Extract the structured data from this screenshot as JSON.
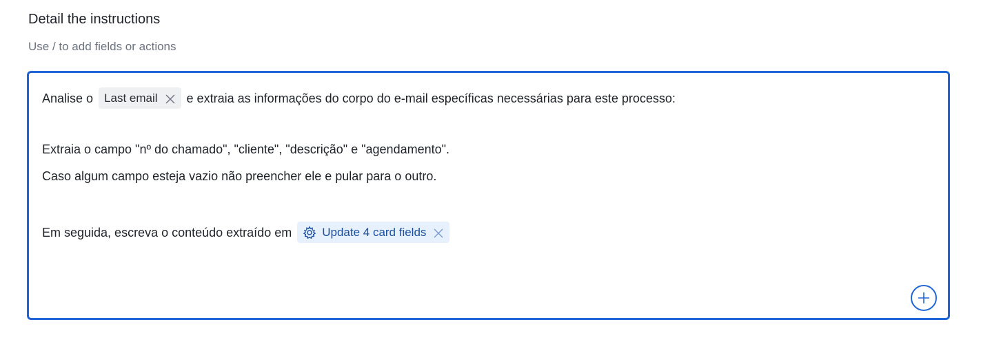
{
  "header": {
    "title": "Detail the instructions",
    "subtitle": "Use / to add fields or actions"
  },
  "editor": {
    "line1": {
      "before": "Analise o",
      "chip_label": "Last email",
      "after": "e extraia as informações do corpo do e-mail específicas necessárias para este processo:"
    },
    "line2": "Extraia o campo \"nº do chamado\", \"cliente\", \"descrição\" e \"agendamento\".",
    "line3": "Caso algum campo esteja vazio não preencher ele e pular para o outro.",
    "line4": {
      "before": "Em seguida, escreva o conteúdo extraído em",
      "chip_label": "Update 4 card fields",
      "chip_icon": "gear-icon"
    }
  },
  "colors": {
    "accent": "#1e66d8",
    "chip_gray_bg": "#eef0f2",
    "chip_blue_bg": "#e7f0fd",
    "chip_blue_text": "#1a4fa0"
  },
  "icons": {
    "add_button": "plus-circle-icon",
    "remove": "close-icon"
  }
}
